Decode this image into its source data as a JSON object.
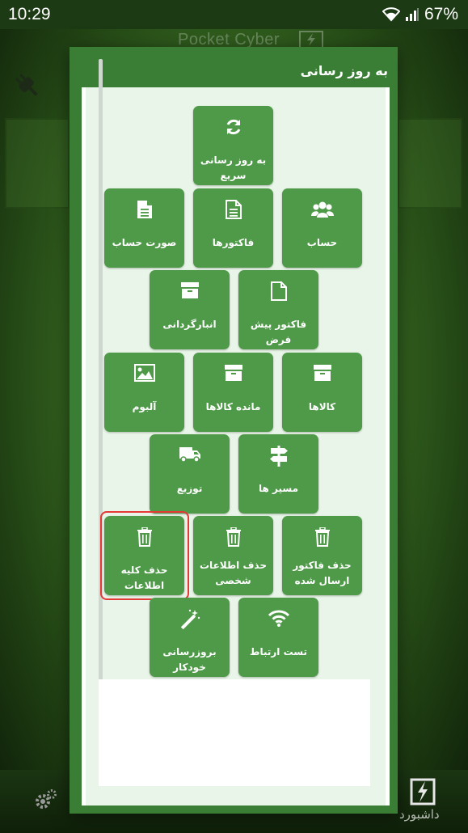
{
  "status_bar": {
    "time": "10:29",
    "battery": "67%"
  },
  "background_app": {
    "title": "Pocket Cyber",
    "dashboard_label": "داشبورد"
  },
  "dialog": {
    "title": "به روز رسانی"
  },
  "tiles": {
    "quick_update": "به روز رسانی سریع",
    "account": "حساب",
    "invoices": "فاکتورها",
    "account_statement": "صورت حساب",
    "proforma_invoice": "فاکتور پیش فرض",
    "inventory": "انبارگردانی",
    "goods": "کالاها",
    "goods_balance": "مانده کالاها",
    "album": "آلبوم",
    "routes": "مسیر ها",
    "distribution": "توزیع",
    "delete_sent_invoice": "حذف فاکتور ارسال شده",
    "delete_personal_info": "حذف اطلاعات شخصی",
    "delete_all_info": "حذف کلیه اطلاعات",
    "connection_test": "تست ارتباط",
    "auto_update": "بروزرسانی خودکار"
  },
  "icons": {
    "quick_update": "refresh-icon",
    "account": "users-icon",
    "invoices": "document-icon",
    "account_statement": "document-icon",
    "proforma_invoice": "blank-document-icon",
    "inventory": "archive-box-icon",
    "goods": "archive-box-icon",
    "goods_balance": "archive-box-icon",
    "album": "image-icon",
    "routes": "signpost-icon",
    "distribution": "truck-icon",
    "delete": "trash-icon",
    "connection_test": "wifi-icon",
    "auto_update": "magic-wand-icon"
  },
  "colors": {
    "dialog_green": "#3a7e36",
    "tile_green": "#4e9a48",
    "highlight_red": "#e53935"
  }
}
